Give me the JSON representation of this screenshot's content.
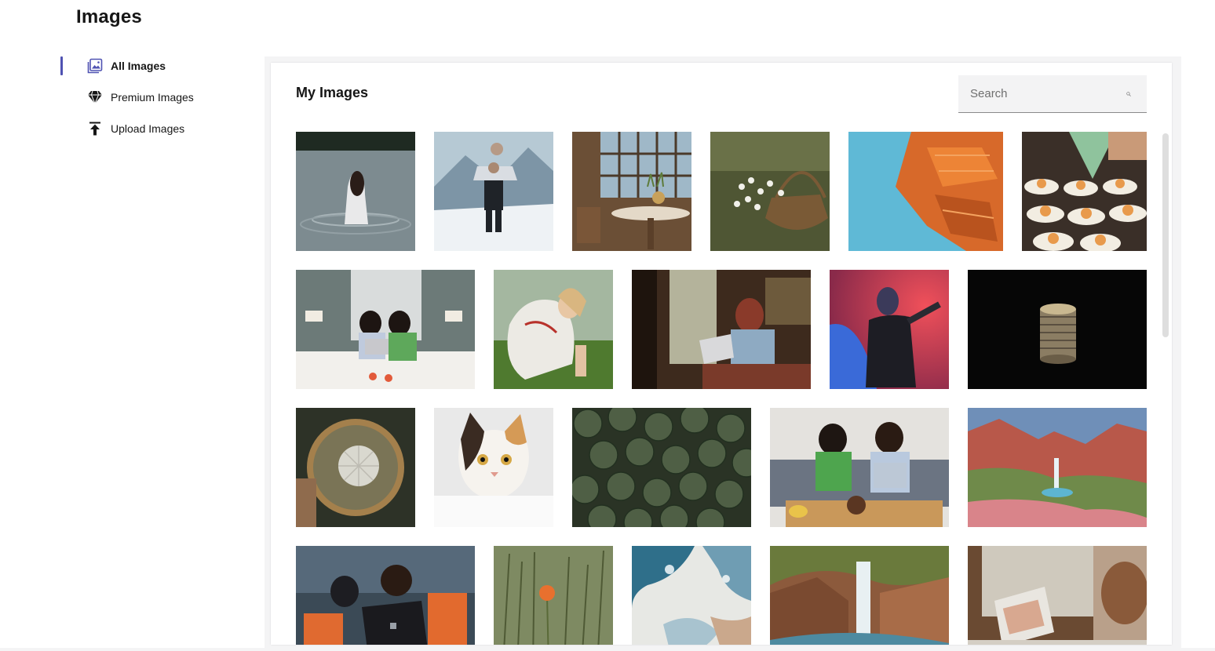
{
  "page": {
    "title": "Images"
  },
  "sidebar": {
    "items": [
      {
        "label": "All Images",
        "icon": "images-icon",
        "active": true
      },
      {
        "label": "Premium Images",
        "icon": "diamond-icon",
        "active": false
      },
      {
        "label": "Upload Images",
        "icon": "upload-icon",
        "active": false
      }
    ]
  },
  "main": {
    "title": "My Images",
    "search": {
      "placeholder": "Search",
      "value": ""
    }
  },
  "colors": {
    "accent": "#4f52b2"
  },
  "gallery": {
    "images": [
      {
        "name": "woman-in-lake"
      },
      {
        "name": "couple-piggyback-snow"
      },
      {
        "name": "cafe-interior-table"
      },
      {
        "name": "flower-basket"
      },
      {
        "name": "orange-tower-sky"
      },
      {
        "name": "dessert-plates"
      },
      {
        "name": "women-laptop-bed"
      },
      {
        "name": "woman-sitting-grass"
      },
      {
        "name": "woman-laptop-window"
      },
      {
        "name": "man-red-blue-light"
      },
      {
        "name": "coin-stack-dark"
      },
      {
        "name": "magnifier-dandelion"
      },
      {
        "name": "calico-cat"
      },
      {
        "name": "green-leaves-pattern"
      },
      {
        "name": "women-couch-laptop"
      },
      {
        "name": "canyon-waterfall"
      },
      {
        "name": "hikers-tablet"
      },
      {
        "name": "poppy-wheat-field"
      },
      {
        "name": "fluid-art-blue"
      },
      {
        "name": "waterfall-cliffs"
      },
      {
        "name": "laptop-window-desk"
      }
    ]
  }
}
